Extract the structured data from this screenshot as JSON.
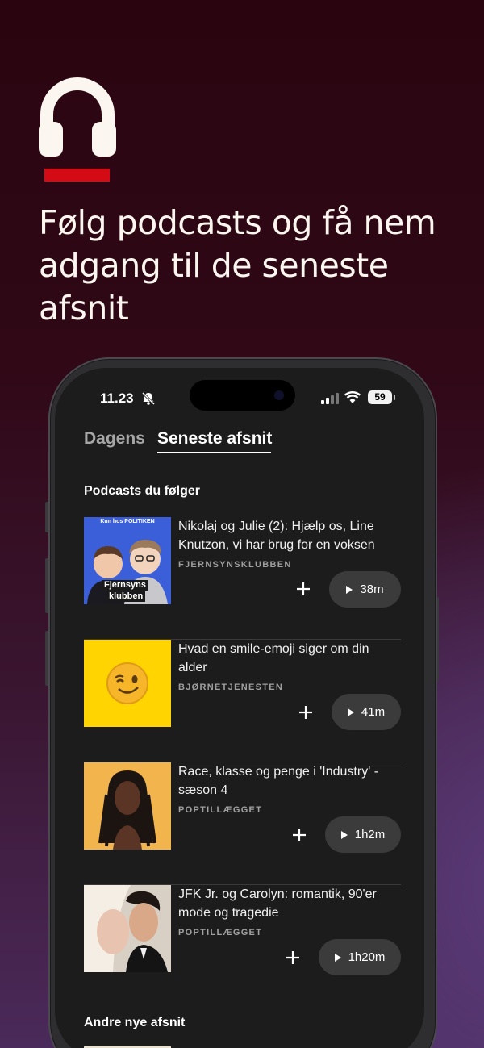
{
  "headline": "Følg podcasts og få nem adgang til de seneste afsnit",
  "status": {
    "time": "11.23",
    "battery": "59"
  },
  "tabs": [
    {
      "label": "Dagens"
    },
    {
      "label": "Seneste afsnit"
    }
  ],
  "sections": {
    "followed": "Podcasts du følger",
    "other": "Andre nye afsnit"
  },
  "episodes": [
    {
      "title": "Nikolaj og Julie (2): Hjælp os, Line Knutzon, vi har brug for en voksen",
      "show": "FJERNSYNSKLUBBEN",
      "duration": "38m",
      "art_top": "Kun hos POLITIKEN",
      "art_text1": "Fjernsyns",
      "art_text2": "klubben"
    },
    {
      "title": "Hvad en smile-emoji siger om din alder",
      "show": "BJØRNETJENESTEN",
      "duration": "41m",
      "art_emoji": "😉"
    },
    {
      "title": "Race, klasse og penge i 'Industry' - sæson 4",
      "show": "POPTILLÆGGET",
      "duration": "1h2m"
    },
    {
      "title": "JFK Jr. og Carolyn: romantik, 90'er mode og tragedie",
      "show": "POPTILLÆGGET",
      "duration": "1h20m"
    }
  ],
  "colors": {
    "accent_red": "#d40a14",
    "emoji_bg": "#ffd400",
    "fjernsyn_bg": "#3a5fd8",
    "race_bg": "#f2b44c"
  },
  "icons": [
    "headphones-icon",
    "bell-slash-icon",
    "signal-icon",
    "wifi-icon",
    "battery-icon",
    "plus-icon",
    "play-icon"
  ]
}
